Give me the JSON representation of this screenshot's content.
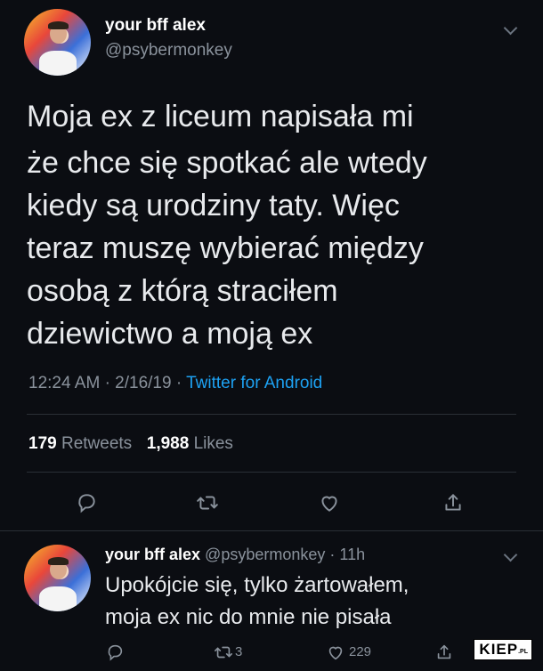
{
  "tweet": {
    "display_name": "your bff alex",
    "handle": "@psybermonkey",
    "text_lines": [
      "Moja ex z liceum napisała mi",
      "że chce się spotkać ale wtedy",
      "kiedy są urodziny taty. Więc",
      "teraz muszę wybierać między",
      "osobą z którą straciłem",
      "dziewictwo a moją ex"
    ],
    "time": "12:24 AM",
    "date": "2/16/19",
    "source": "Twitter for Android",
    "retweets_count": "179",
    "retweets_label": "Retweets",
    "likes_count": "1,988",
    "likes_label": "Likes",
    "actions": [
      "reply-icon",
      "retweet-icon",
      "like-icon",
      "share-icon"
    ]
  },
  "reply": {
    "display_name": "your bff alex",
    "handle": "@psybermonkey",
    "time_ago": "11h",
    "text_lines": [
      "Upokójcie się, tylko żartowałem,",
      "moja ex nic do mnie nie pisała"
    ],
    "retweets": "3",
    "likes": "229"
  },
  "watermark": {
    "brand": "KIEP",
    "suffix": ".PL"
  },
  "colors": {
    "background": "#0b0d12",
    "text": "#e8eaed",
    "muted": "#8a929c",
    "link": "#1da1f2"
  }
}
